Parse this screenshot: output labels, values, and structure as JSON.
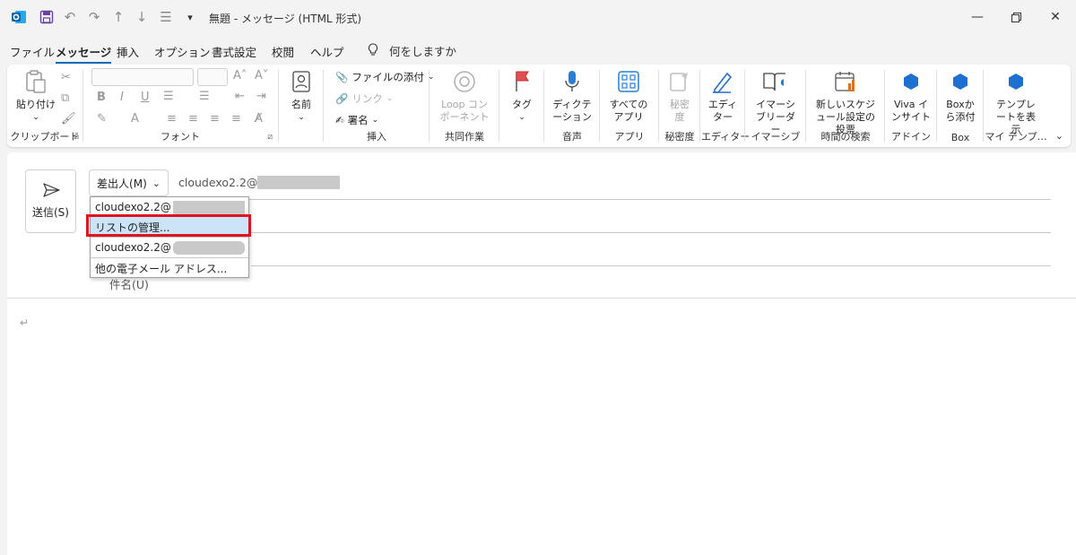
{
  "window": {
    "title": "無題 - メッセージ (HTML 形式)"
  },
  "menu": {
    "tabs": [
      "ファイル",
      "メッセージ",
      "挿入",
      "オプション",
      "書式設定",
      "校閲",
      "ヘルプ"
    ],
    "active": "メッセージ",
    "tell_me": "何をしますか"
  },
  "ribbon": {
    "clipboard": {
      "paste": "貼り付け",
      "label": "クリップボード"
    },
    "font": {
      "label": "フォント",
      "bold": "B",
      "italic": "I",
      "underline": "U"
    },
    "names": {
      "button": "名前"
    },
    "insert": {
      "attach": "ファイルの添付",
      "link": "リンク",
      "signature": "署名",
      "label": "挿入"
    },
    "collab": {
      "loop": "Loop コンポーネント",
      "label": "共同作業"
    },
    "tags": {
      "button": "タグ"
    },
    "voice": {
      "button": "ディクテーション",
      "label": "音声"
    },
    "apps": {
      "button": "すべてのアプリ",
      "label": "アプリ"
    },
    "sensitivity": {
      "button": "秘密度",
      "label": "秘密度"
    },
    "editor": {
      "button": "エディター",
      "label": "エディター"
    },
    "immersive": {
      "button": "イマーシブリーダー",
      "label": "イマーシブ"
    },
    "schedule": {
      "button": "新しいスケジュール設定の投票",
      "label": "時間の検索"
    },
    "addin": {
      "button": "Viva インサイト",
      "label": "アドイン"
    },
    "box": {
      "button": "Boxから添付",
      "label": "Box"
    },
    "templates": {
      "button": "テンプレートを表示",
      "label": "マイ テンプ…"
    }
  },
  "compose": {
    "send": "送信(S)",
    "from": "差出人(M)",
    "from_address": "cloudexo2.2@",
    "subject": "件名(U)",
    "body_mark": "↵"
  },
  "dropdown": {
    "items": [
      {
        "label": "cloudexo2.2@"
      },
      {
        "label": "リストの管理..."
      },
      {
        "label": "cloudexo2.2@"
      },
      {
        "label": "他の電子メール アドレス..."
      }
    ]
  },
  "colors": {
    "accent": "#0f6cbd",
    "highlight": "#e0141e",
    "selected": "#cce4f7"
  }
}
